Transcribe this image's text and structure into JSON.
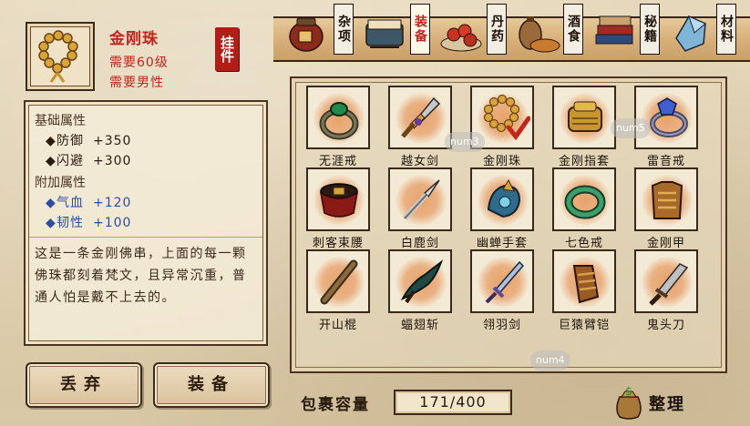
{
  "selected_item": {
    "name": "金刚珠",
    "requirement_level": "需要60级",
    "requirement_gender": "需要男性",
    "hang_label": "挂件",
    "icon": "prayer-beads-icon"
  },
  "tabs": [
    {
      "label": "杂项",
      "icon": "jar-icon"
    },
    {
      "label": "装备",
      "icon": "scroll-armor-icon",
      "active": true
    },
    {
      "label": "丹药",
      "icon": "pills-icon"
    },
    {
      "label": "酒食",
      "icon": "wine-food-icon"
    },
    {
      "label": "秘籍",
      "icon": "books-icon"
    },
    {
      "label": "材料",
      "icon": "crystal-icon"
    }
  ],
  "attributes": {
    "base_title": "基础属性",
    "base": [
      {
        "name": "防御",
        "value": "+350"
      },
      {
        "name": "闪避",
        "value": "+300"
      }
    ],
    "extra_title": "附加属性",
    "extra": [
      {
        "name": "气血",
        "value": "+120"
      },
      {
        "name": "韧性",
        "value": "+100"
      }
    ],
    "description": "这是一条金刚佛串，上面的每一颗佛珠都刻着梵文，且异常沉重，普通人怕是戴不上去的。"
  },
  "buttons": {
    "discard": "丢弃",
    "equip": "装备"
  },
  "inventory": {
    "items": [
      {
        "label": "无涯戒",
        "icon": "green-ring-icon"
      },
      {
        "label": "越女剑",
        "icon": "dagger-icon"
      },
      {
        "label": "金刚珠",
        "icon": "prayer-beads-icon",
        "equipped": true
      },
      {
        "label": "金刚指套",
        "icon": "gold-finger-guard-icon"
      },
      {
        "label": "雷音戒",
        "icon": "blue-gem-ring-icon"
      },
      {
        "label": "刺客束腰",
        "icon": "belt-icon"
      },
      {
        "label": "白鹿剑",
        "icon": "spear-tip-icon"
      },
      {
        "label": "幽蝉手套",
        "icon": "blue-gauntlet-icon"
      },
      {
        "label": "七色戒",
        "icon": "jade-ring-icon"
      },
      {
        "label": "金刚甲",
        "icon": "gold-armor-icon"
      },
      {
        "label": "开山棍",
        "icon": "staff-icon"
      },
      {
        "label": "蝠翅斩",
        "icon": "bat-blade-icon"
      },
      {
        "label": "翎羽剑",
        "icon": "feather-sword-icon"
      },
      {
        "label": "巨猿臂铠",
        "icon": "arm-guard-icon"
      },
      {
        "label": "鬼头刀",
        "icon": "broadsword-icon"
      }
    ],
    "overlay_tags": [
      "num3",
      "num5",
      "num4"
    ]
  },
  "capacity": {
    "label": "包裹容量",
    "value": "171/400"
  },
  "sort": {
    "label": "整理",
    "icon": "money-bag-icon"
  }
}
